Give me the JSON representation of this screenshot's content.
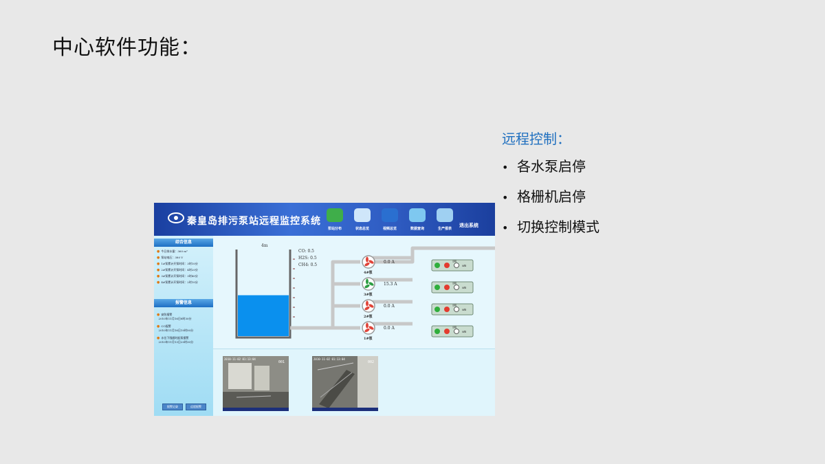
{
  "slide": {
    "title": "中心软件功能：",
    "panel_title": "远程控制：",
    "bullets": [
      "各水泵启停",
      "格栅机启停",
      "切换控制模式"
    ]
  },
  "app": {
    "title": "秦皇岛排污泵站远程监控系统",
    "nav": [
      {
        "label": "泵站分布",
        "icon": "map-icon",
        "color": "#3fae4a"
      },
      {
        "label": "状态总览",
        "icon": "overview-icon",
        "color": "#cfe6fa"
      },
      {
        "label": "视频总览",
        "icon": "monitor-icon",
        "color": "#2a6fd0"
      },
      {
        "label": "数据查询",
        "icon": "cloud-icon",
        "color": "#7ec8f0"
      },
      {
        "label": "生产报表",
        "icon": "report-icon",
        "color": "#9fd0f2"
      }
    ],
    "exit_label": "退出系统",
    "info_title": "综合信息",
    "info_items": [
      "今日排水量：360 m³",
      "泵站电压：380 V",
      "1#泵累计开泵时间：3时10分",
      "2#泵累计开泵时间：4时20分",
      "3#泵累计开泵时间：3时40分",
      "4#泵累计开泵时间：2时10分"
    ],
    "alarm_title": "报警信息",
    "alarm_items": [
      {
        "name": "安防报警",
        "time": "2010年11月16日8时30分"
      },
      {
        "name": "CO报警",
        "time": "2010年11月16日10时50分"
      },
      {
        "name": "水位下限超时起泵报警",
        "time": "2010年11月13日20时30分"
      }
    ],
    "side_buttons": [
      "报警记录",
      "远程报警"
    ],
    "tank_level_label": "4m",
    "gases": [
      "CO: 0.5",
      "H2S: 0.5",
      "CH4: 0.5"
    ],
    "pumps": [
      {
        "name": "4#泵",
        "current": "0.0 A",
        "color": "#e0453a"
      },
      {
        "name": "3#泵",
        "current": "15.3 A",
        "color": "#2e9e44"
      },
      {
        "name": "2#泵",
        "current": "0.0 A",
        "color": "#e0453a"
      },
      {
        "name": "1#泵",
        "current": "0.0 A",
        "color": "#e0453a"
      }
    ],
    "panel_mode_top": "远程",
    "panel_mode_side": "远程",
    "water_level": 0.48,
    "videos": [
      {
        "timestamp": "2010-11-02 01:13:04",
        "camera": "001"
      },
      {
        "timestamp": "2010-11-02 01:13:04",
        "camera": "002"
      }
    ]
  }
}
